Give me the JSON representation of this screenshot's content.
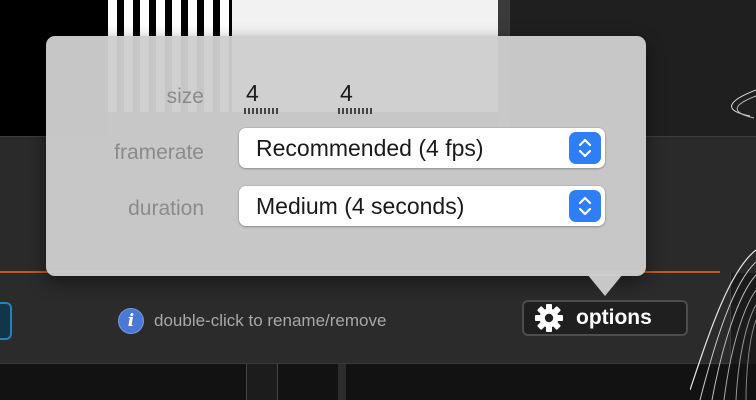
{
  "popover": {
    "size": {
      "label": "size",
      "width_value": "4",
      "height_value": "4"
    },
    "framerate": {
      "label": "framerate",
      "value": "Recommended (4 fps)"
    },
    "duration": {
      "label": "duration",
      "value": "Medium (4 seconds)"
    }
  },
  "footer": {
    "info_icon": "info-icon",
    "hint": "double-click to rename/remove",
    "options_icon": "gear-icon",
    "options_label": "options"
  },
  "colors": {
    "accent_blue": "#2f7ef5",
    "info_blue": "#4b78d4",
    "orange_line": "#c35a12"
  }
}
